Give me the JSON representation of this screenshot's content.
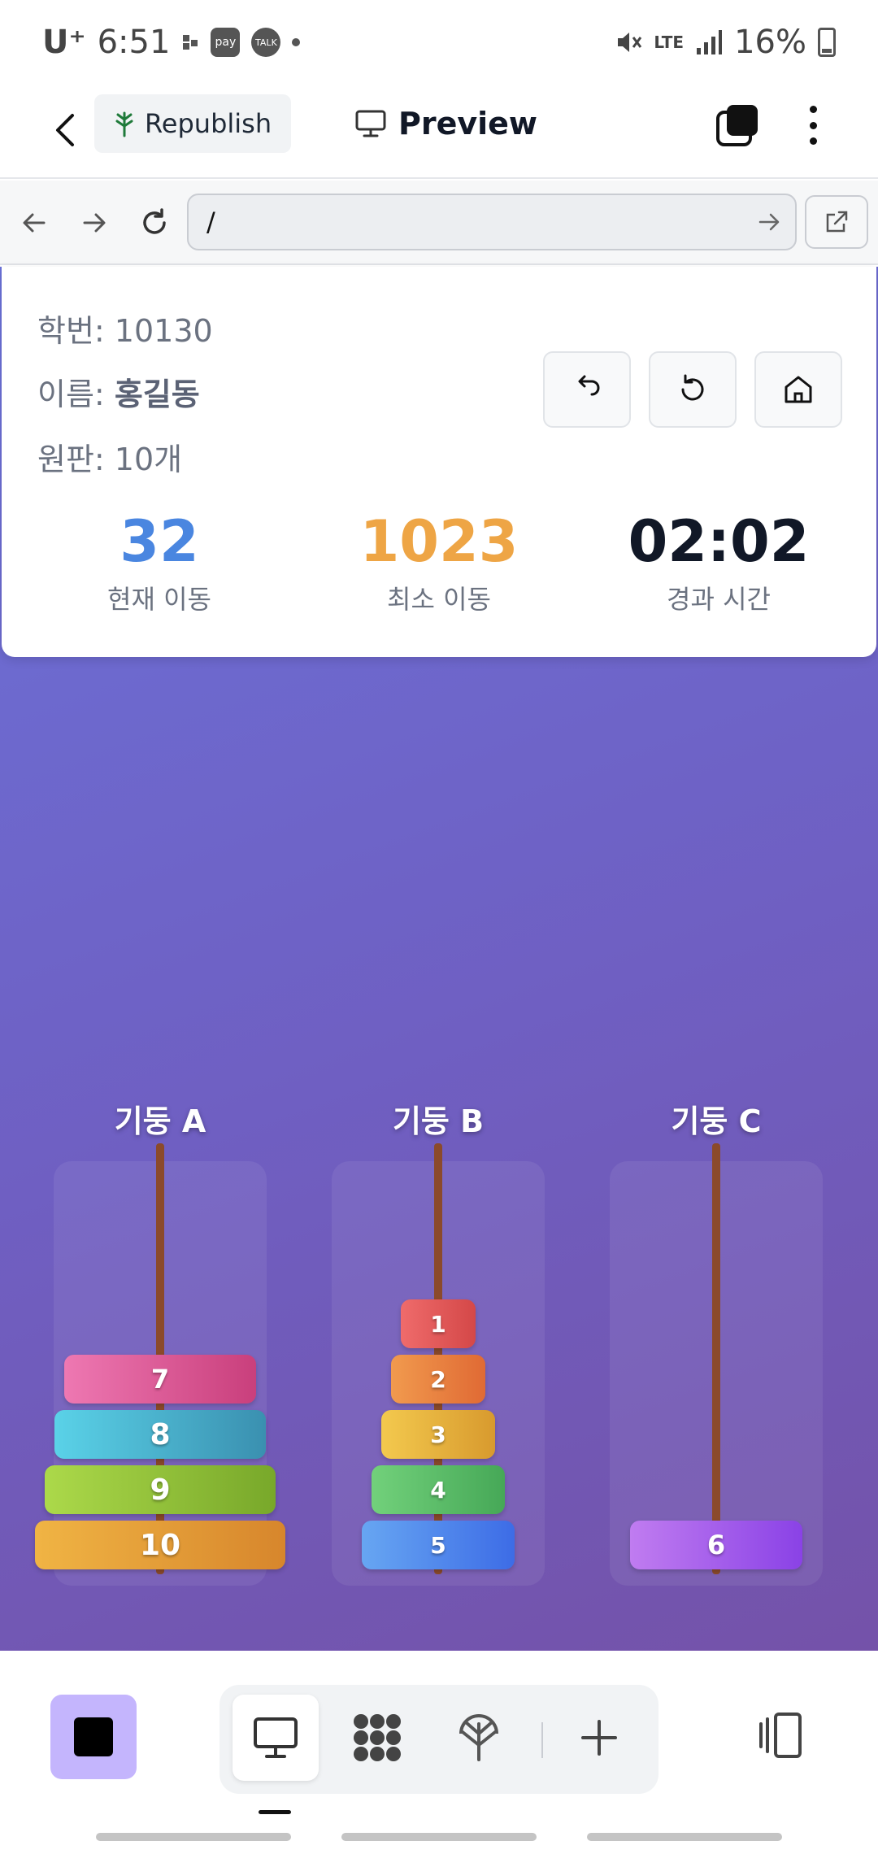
{
  "status_bar": {
    "carrier": "U⁺",
    "time": "6:51",
    "app_icons": [
      "pay",
      "TALK"
    ],
    "network": "LTE",
    "battery": "16%"
  },
  "app_header": {
    "republish_label": "Republish",
    "preview_label": "Preview"
  },
  "browser": {
    "url": "/"
  },
  "game": {
    "student_id": "학번: 10130",
    "name_label": "이름: ",
    "name_value": "홍길동",
    "disks_info": "원판: 10개",
    "stats": [
      {
        "value": "32",
        "label": "현재 이동",
        "color": "#4a86e0"
      },
      {
        "value": "1023",
        "label": "최소 이동",
        "color": "#eea545"
      },
      {
        "value": "02:02",
        "label": "경과 시간",
        "color": "#111827"
      }
    ],
    "pegs": [
      {
        "label": "기둥 A",
        "disks": [
          7,
          8,
          9,
          10
        ]
      },
      {
        "label": "기둥 B",
        "disks": [
          1,
          2,
          3,
          4,
          5
        ]
      },
      {
        "label": "기둥 C",
        "disks": [
          6
        ]
      }
    ],
    "disk_colors": {
      "1": [
        "#ef6b6b",
        "#d44848"
      ],
      "2": [
        "#f19a4e",
        "#e06a34"
      ],
      "3": [
        "#f3c94e",
        "#d89a2e"
      ],
      "4": [
        "#72d17b",
        "#46a857"
      ],
      "5": [
        "#67a6f2",
        "#3d6ce6"
      ],
      "6": [
        "#c07cf0",
        "#8a42e6"
      ],
      "7": [
        "#ee78b2",
        "#c93f7c"
      ],
      "8": [
        "#5ad2e8",
        "#3a90b0"
      ],
      "9": [
        "#acd94a",
        "#78a82a"
      ],
      "10": [
        "#f0b444",
        "#d7862c"
      ]
    }
  }
}
